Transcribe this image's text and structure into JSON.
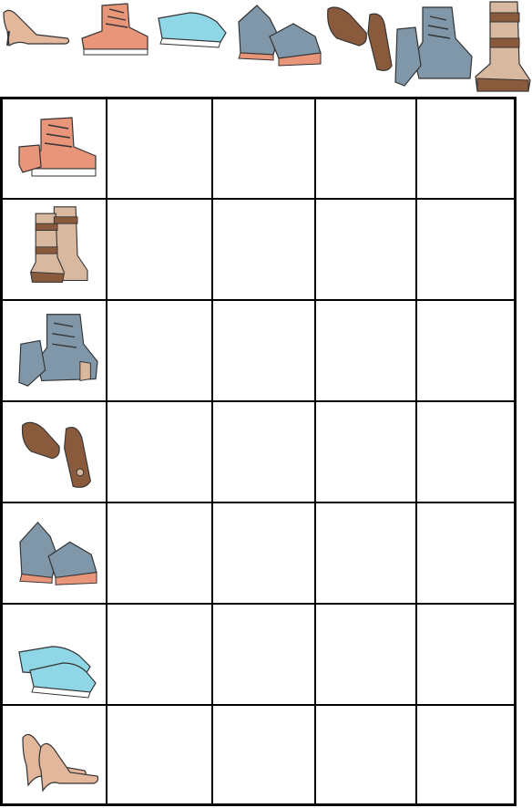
{
  "puzzle": {
    "shoe_sequence": [
      "heels",
      "lace-up-boots",
      "slip-on-sneakers",
      "running-sneakers",
      "loafers",
      "heeled-ankle-boots",
      "tall-buckle-boots"
    ],
    "row_labels": [
      "lace-up-boots",
      "tall-buckle-boots",
      "heeled-ankle-boots",
      "loafers",
      "running-sneakers",
      "slip-on-sneakers",
      "heels"
    ],
    "empty_columns": 4
  },
  "colors": {
    "salmon": "#e8957a",
    "light_blue": "#8fd6e6",
    "gray_blue": "#7f97a8",
    "brown": "#8a5a3c",
    "tan": "#d9b8a0",
    "line": "#000000"
  }
}
